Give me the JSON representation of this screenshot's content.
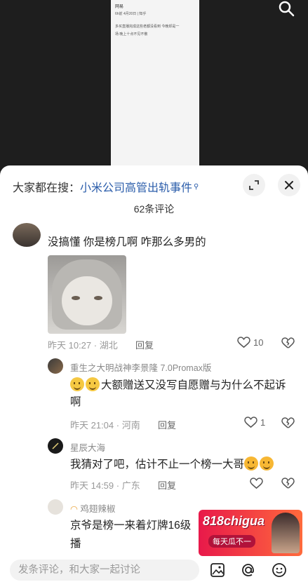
{
  "doc": {
    "line1": "网易",
    "line2": "6h前 4月20日 | 知乎",
    "line3": "多买直播完成这些老都没看到 今晚却是一",
    "line4": "场 晚上十点不见不散"
  },
  "search_prefix": "大家都在搜：",
  "search_term": "小米公司高管出轨事件",
  "comment_count": "62条评论",
  "comments": [
    {
      "name": "",
      "text": "没搞懂 你是榜几啊 咋那么多男的",
      "meta": "昨天 10:27 · 湖北",
      "reply": "回复",
      "likes": "10"
    },
    {
      "name": "重生之大明战神李景隆 7.0Promax版",
      "text": "大额赠送又没写自愿赠与为什么不起诉啊",
      "meta": "昨天 21:04 · 河南",
      "reply": "回复",
      "likes": "1"
    },
    {
      "name": "星辰大海",
      "text": "我猜对了吧，估计不止一个榜一大哥",
      "meta": "昨天 14:59 · 广东",
      "reply": "回复",
      "likes": ""
    },
    {
      "name": "鸡翅辣椒",
      "text": "京爷是榜一来着灯牌16级",
      "text2": "播",
      "meta": "",
      "reply": "",
      "likes": ""
    }
  ],
  "input_placeholder": "发条评论，和大家一起讨论",
  "ad": {
    "brand": "818chigua",
    "sub": "每天瓜不一"
  },
  "colors": {
    "link": "#2a5caa",
    "sheet": "#ffffff",
    "backdrop": "#1e1e1e"
  }
}
